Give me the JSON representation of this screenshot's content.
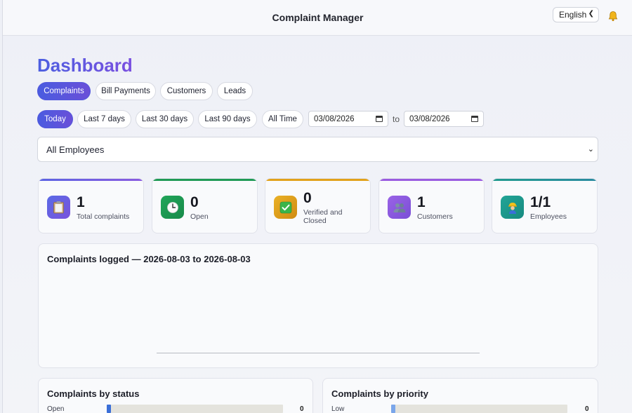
{
  "app": {
    "title": "Complaint Manager",
    "language": "English"
  },
  "page": {
    "heading": "Dashboard"
  },
  "tabs": [
    "Complaints",
    "Bill Payments",
    "Customers",
    "Leads"
  ],
  "active_tab": "Complaints",
  "ranges": [
    "Today",
    "Last 7 days",
    "Last 30 days",
    "Last 90 days",
    "All Time"
  ],
  "active_range": "Today",
  "date_from": "03/08/2026",
  "date_to": "03/08/2026",
  "to_label": "to",
  "employee_filter": "All Employees",
  "stats": [
    {
      "value": "1",
      "label": "Total complaints",
      "icon": "clipboard-icon",
      "accent": "#7b5be3",
      "icon_bg": "#5a58e0"
    },
    {
      "value": "0",
      "label": "Open",
      "icon": "clock-icon",
      "accent": "#1f9a55",
      "icon_bg": "#1f9a55"
    },
    {
      "value": "0",
      "label": "Verified and Closed",
      "icon": "check-icon",
      "accent": "#e2a21a",
      "icon_bg": "#e2a21a"
    },
    {
      "value": "1",
      "label": "Customers",
      "icon": "users-icon",
      "accent": "#9a5be0",
      "icon_bg": "#8a55e0"
    },
    {
      "value": "1/1",
      "label": "Employees",
      "icon": "worker-icon",
      "accent": "#1f9a8e",
      "icon_bg": "#1f9a8e"
    }
  ],
  "logged_panel": {
    "title": "Complaints logged — 2026-08-03 to 2026-08-03"
  },
  "status_panel": {
    "title": "Complaints by status",
    "rows": [
      {
        "label": "Open",
        "count": "0"
      }
    ]
  },
  "priority_panel": {
    "title": "Complaints by priority",
    "rows": [
      {
        "label": "Low",
        "count": "0"
      }
    ]
  },
  "colors": {
    "primary": "#4a5ce0",
    "secondary": "#6a4fd8",
    "bar_status": "#3b6fd8",
    "bar_priority": "#7aa6ea"
  }
}
